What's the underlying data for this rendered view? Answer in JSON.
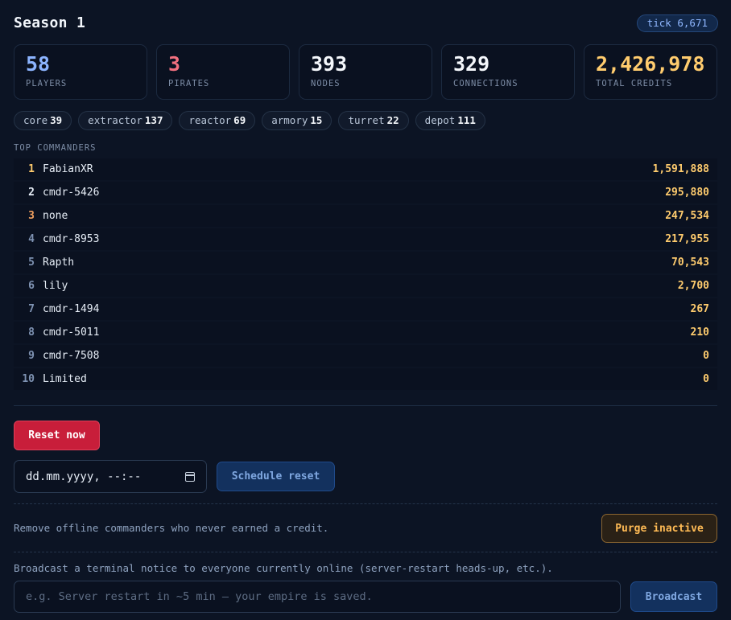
{
  "header": {
    "title": "Season 1",
    "tick": "tick 6,671"
  },
  "stats": [
    {
      "value": "58",
      "label": "PLAYERS",
      "color": "#8cb4ff"
    },
    {
      "value": "3",
      "label": "PIRATES",
      "color": "#f2707f"
    },
    {
      "value": "393",
      "label": "NODES",
      "color": "#f4f7fb"
    },
    {
      "value": "329",
      "label": "CONNECTIONS",
      "color": "#f4f7fb"
    },
    {
      "value": "2,426,978",
      "label": "TOTAL CREDITS",
      "color": "#ffcc6e"
    }
  ],
  "node_types": [
    {
      "name": "core",
      "count": "39"
    },
    {
      "name": "extractor",
      "count": "137"
    },
    {
      "name": "reactor",
      "count": "69"
    },
    {
      "name": "armory",
      "count": "15"
    },
    {
      "name": "turret",
      "count": "22"
    },
    {
      "name": "depot",
      "count": "111"
    }
  ],
  "leaderboard": {
    "label": "TOP COMMANDERS",
    "rows": [
      {
        "rank": "1",
        "name": "FabianXR",
        "credits": "1,591,888"
      },
      {
        "rank": "2",
        "name": "cmdr-5426",
        "credits": "295,880"
      },
      {
        "rank": "3",
        "name": "none",
        "credits": "247,534"
      },
      {
        "rank": "4",
        "name": "cmdr-8953",
        "credits": "217,955"
      },
      {
        "rank": "5",
        "name": "Rapth",
        "credits": "70,543"
      },
      {
        "rank": "6",
        "name": "lily",
        "credits": "2,700"
      },
      {
        "rank": "7",
        "name": "cmdr-1494",
        "credits": "267"
      },
      {
        "rank": "8",
        "name": "cmdr-5011",
        "credits": "210"
      },
      {
        "rank": "9",
        "name": "cmdr-7508",
        "credits": "0"
      },
      {
        "rank": "10",
        "name": "Limited",
        "credits": "0"
      }
    ]
  },
  "reset": {
    "reset_now_label": "Reset now",
    "date_value": "dd.mm.yyyy, --:--",
    "schedule_label": "Schedule reset"
  },
  "purge": {
    "description": "Remove offline commanders who never earned a credit.",
    "button_label": "Purge inactive"
  },
  "broadcast": {
    "description": "Broadcast a terminal notice to everyone currently online (server-restart heads-up, etc.).",
    "placeholder": "e.g. Server restart in ~5 min — your empire is saved.",
    "button_label": "Broadcast"
  }
}
